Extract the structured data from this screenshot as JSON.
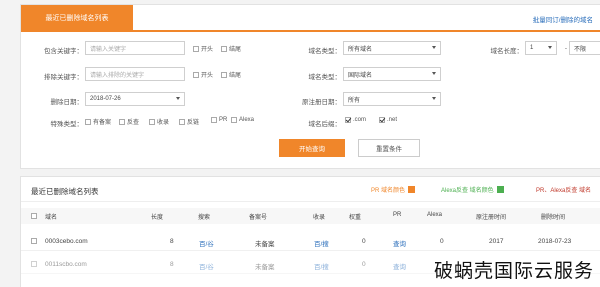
{
  "header": {
    "active_tab": "最近已删除域名列表",
    "top_link": "批量同订/删除的域名"
  },
  "filters": {
    "include_kw_label": "包含关键字：",
    "include_kw_placeholder": "请输入关键字",
    "exclude_kw_label": "排除关键字：",
    "exclude_kw_placeholder": "请输入排除的关键字",
    "delete_date_label": "删除日期：",
    "delete_date_value": "2018-07-26",
    "type_label": "特殊类型：",
    "pos_start": "开头",
    "pos_end": "结尾",
    "pos_start2": "开头",
    "pos_end2": "结尾",
    "domain_type_label": "域名类型：",
    "domain_type_value": "所有域名",
    "exclude_type_label": "域名类型：",
    "exclude_type_value": "国际域名",
    "register_date_label": "原注册日期：",
    "register_date_value": "所有",
    "suffix_label": "域名后缀：",
    "suffix_com": ".com",
    "suffix_net": ".net",
    "length_label": "域名长度：",
    "length_value": "1",
    "length_sep": "-",
    "length_limit": "不限",
    "types": [
      "有备案",
      "反查",
      "收录",
      "反链",
      "PR",
      "Alexa"
    ]
  },
  "buttons": {
    "search": "开始查询",
    "reset": "重置条件"
  },
  "list": {
    "title": "最近已删除域名列表",
    "legends": [
      {
        "label": "PR 域名颜色",
        "color": "#f0862a"
      },
      {
        "label": "Alexa反查 域名颜色",
        "color": "#4caf50"
      },
      {
        "label": "PR、Alexa反查 域名"
      }
    ],
    "columns": [
      "域名",
      "长度",
      "搜索",
      "备案号",
      "收录",
      "权重",
      "PR",
      "Alexa",
      "原注册时间",
      "删除时间"
    ],
    "rows": [
      {
        "domain": "0003cebo.com",
        "length": "8",
        "search": "百/谷",
        "beian": "未备案",
        "index": "百/搜",
        "weight": "0",
        "pr": "查询",
        "alexa": "0",
        "reg": "2017",
        "del": "2018-07-23"
      },
      {
        "domain": "0011scbo.com",
        "length": "8",
        "search": "百/谷",
        "beian": "未备案",
        "index": "百/搜",
        "weight": "0",
        "pr": "查询",
        "alexa": "",
        "reg": "",
        "del": ""
      }
    ]
  },
  "watermark": "破蜗壳国际云服务"
}
